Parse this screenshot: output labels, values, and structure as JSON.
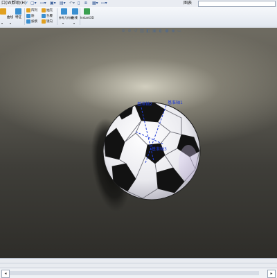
{
  "toolbar": {
    "menu1": "口(W)",
    "menu2": "帮助(H)",
    "doc_title": "图表",
    "buttons": [
      {
        "label": "曲线",
        "color": "#e0a020"
      },
      {
        "label": "特征",
        "color": "#3a8fd0"
      },
      {
        "label": "阵列",
        "color": "#e0a020"
      },
      {
        "label": "筋",
        "color": "#3a8fd0"
      },
      {
        "label": "拔模",
        "color": "#3a8fd0"
      },
      {
        "label": "抽壳",
        "color": "#e0a020"
      },
      {
        "label": "包覆",
        "color": "#3a8fd0"
      },
      {
        "label": "镜向",
        "color": "#e0a020"
      },
      {
        "label": "参考几何体",
        "color": "#3a8fd0"
      },
      {
        "label": "曲线",
        "color": "#3a8fd0"
      },
      {
        "label": "Instant3D",
        "color": "#3aa050"
      }
    ]
  },
  "viewport": {
    "labels": {
      "axis1": "基准轴1",
      "axis2": "基准轴2",
      "axis3": "基准轴3"
    },
    "background_color": "#4a4840",
    "axis_color": "#1f3bd6"
  },
  "status": {}
}
